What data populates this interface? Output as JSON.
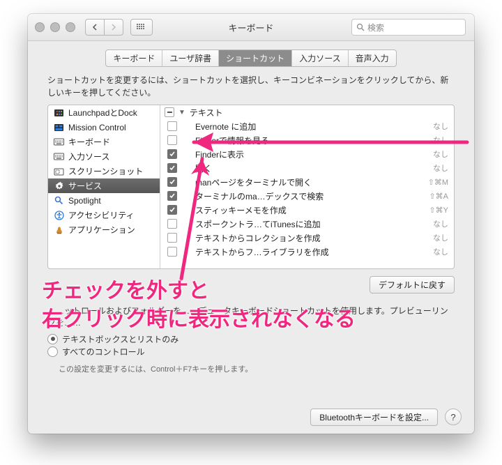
{
  "window": {
    "title": "キーボード"
  },
  "search": {
    "placeholder": "検索"
  },
  "tabs": [
    {
      "label": "キーボード",
      "active": false
    },
    {
      "label": "ユーザ辞書",
      "active": false
    },
    {
      "label": "ショートカット",
      "active": true
    },
    {
      "label": "入力ソース",
      "active": false
    },
    {
      "label": "音声入力",
      "active": false
    }
  ],
  "instruction": "ショートカットを変更するには、ショートカットを選択し、キーコンビネーションをクリックしてから、新しいキーを押してください。",
  "categories": [
    {
      "label": "LaunchpadとDock",
      "icon": "launchpad",
      "selected": false
    },
    {
      "label": "Mission Control",
      "icon": "mission",
      "selected": false
    },
    {
      "label": "キーボード",
      "icon": "keyboard",
      "selected": false
    },
    {
      "label": "入力ソース",
      "icon": "keyboard",
      "selected": false
    },
    {
      "label": "スクリーンショット",
      "icon": "screenshot",
      "selected": false
    },
    {
      "label": "サービス",
      "icon": "services",
      "selected": true
    },
    {
      "label": "Spotlight",
      "icon": "spotlight",
      "selected": false
    },
    {
      "label": "アクセシビリティ",
      "icon": "accessibility",
      "selected": false
    },
    {
      "label": "アプリケーション",
      "icon": "app",
      "selected": false
    }
  ],
  "group_header": "テキスト",
  "services": [
    {
      "checked": false,
      "label": "Evernote に追加",
      "shortcut": "なし"
    },
    {
      "checked": false,
      "label": "Finderで情報を見る",
      "shortcut": "なし"
    },
    {
      "checked": true,
      "label": "Finderに表示",
      "shortcut": "なし"
    },
    {
      "checked": true,
      "label": "開く",
      "shortcut": "なし"
    },
    {
      "checked": true,
      "label": "manページをターミナルで開く",
      "shortcut": "⇧⌘M"
    },
    {
      "checked": true,
      "label": "ターミナルのma…デックスで検索",
      "shortcut": "⇧⌘A"
    },
    {
      "checked": true,
      "label": "スティッキーメモを作成",
      "shortcut": "⇧⌘Y"
    },
    {
      "checked": false,
      "label": "スポークントラ…てiTunesに追加",
      "shortcut": "なし"
    },
    {
      "checked": false,
      "label": "テキストからコレクションを作成",
      "shortcut": "なし"
    },
    {
      "checked": false,
      "label": "テキストからフ…ライブラリを作成",
      "shortcut": "なし"
    }
  ],
  "defaults_button": "デフォルトに戻す",
  "accessibility": {
    "desc_obscured": "……ットロールおよびフォルダーを……デュータキーボードショートカットを使用します。プレビューリンクを……",
    "radio1_obscured": "テキストボックスとリストのみ",
    "radio2": "すべてのコントロール",
    "hint": "この設定を変更するには、Control＋F7キーを押します。"
  },
  "bottom": {
    "bluetooth_button": "Bluetoothキーボードを設定..."
  },
  "annotation": {
    "line1": "チェックを外すと",
    "line2": "右クリック時に表示されなくなる"
  }
}
